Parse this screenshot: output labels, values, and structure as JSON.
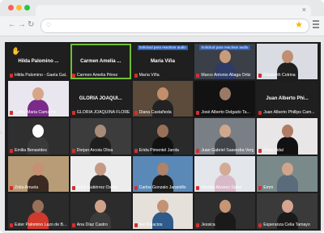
{
  "browser": {
    "tab_close": "×",
    "nav_back": "←",
    "nav_forward": "→",
    "nav_reload": "↻",
    "url_text": "",
    "globe_icon": "globe-icon",
    "star_icon": "star-icon",
    "menu_icon": "hamburger-menu-icon"
  },
  "meeting": {
    "tiles": [
      {
        "center": "Hilda Palomino ...",
        "name": "Hilda Palomino - Gaela Gal...",
        "hand": "✋",
        "bg": "#1f1f1f",
        "person": false
      },
      {
        "center": "Carmen Amelia ...",
        "name": "Carmen Amelia Pérez",
        "bg": "#1f1f1f",
        "active": true,
        "person": false
      },
      {
        "center": "María Viña",
        "tag": "Solicitud para reactivar audio",
        "name": "María Viña",
        "bg": "#1f1f1f",
        "person": false
      },
      {
        "tag": "Solicitud para reactivar audio",
        "name": "Marco Antonio Aliaga Ortiz",
        "bg": "#3b3f47",
        "person": true,
        "skin": "#c99b7d",
        "shirt": "#2e3b66"
      },
      {
        "name": "Elizabeth Cotrina",
        "bg": "#d9dde3",
        "person": true,
        "skin": "#c18d73",
        "shirt": "#202020"
      },
      {
        "name": "Cathy Maria Camacho",
        "bg": "#e9e6ef",
        "person": true,
        "skin": "#d7a587",
        "shirt": "#7a2a8a"
      },
      {
        "center": "GLORIA JOAQUI...",
        "name": "GLORIA JOAQUINA FLORE...",
        "bg": "#1f1f1f",
        "person": false
      },
      {
        "name": "Diana Castañeda",
        "bg": "#5c4a3b",
        "person": true,
        "skin": "#c48e6d",
        "shirt": "#222"
      },
      {
        "name": "José Alberto Delgado Ta...",
        "bg": "#121212",
        "person": true,
        "skin": "#9a7a65",
        "shirt": "#111"
      },
      {
        "center": "Juan Alberto Phi...",
        "name": "Juan Alberto Phillips Cam...",
        "bg": "#1f1f1f",
        "person": false
      },
      {
        "name": "Emilia Benavides",
        "bg": "#2f2f2f",
        "person": true,
        "skin": "#ffffff",
        "shirt": "#3a3a3a"
      },
      {
        "name": "Dorjan Arcoia Oliva",
        "bg": "#3c3c3c",
        "person": true,
        "skin": "#a88c79",
        "shirt": "#1e1e1e"
      },
      {
        "name": "Erida Pimentel Jarola",
        "bg": "#2a2a2a",
        "person": true,
        "skin": "#9b7059",
        "shirt": "#111"
      },
      {
        "name": "Juan Gabriel Saavedra Vergara",
        "bg": "#7a7f86",
        "person": true,
        "skin": "#cfa88c",
        "shirt": "#41444a"
      },
      {
        "name": "Frida Vidal",
        "bg": "#e8e6e6",
        "person": true,
        "skin": "#b07c63",
        "shirt": "#111"
      },
      {
        "name": "Zoila Arruela",
        "bg": "#b89b77",
        "person": true,
        "skin": "#c79073",
        "shirt": "#3a2a22"
      },
      {
        "name": "Erick Gutiérrez Osore",
        "bg": "#ececec",
        "person": true,
        "skin": "#c59a85",
        "shirt": "#2a2a2a"
      },
      {
        "name": "Carlos Gonzalo Jaramillo",
        "bg": "#5a89b7",
        "person": true,
        "skin": "#b08268",
        "shirt": "#1d1d1d"
      },
      {
        "name": "Mariela Alvarez Salas",
        "bg": "#e3e6ea",
        "person": true,
        "skin": "#d3aa95",
        "shirt": "#d8b9c7"
      },
      {
        "name": "Emm",
        "bg": "#7a8a8a",
        "person": true,
        "skin": "#cfa58c",
        "shirt": "#5a6b7a"
      },
      {
        "name": "Ester Palomino Lazo de B...",
        "bg": "#2b2b2b",
        "person": true,
        "skin": "#9a6f59",
        "shirt": "#d0392b"
      },
      {
        "name": "Ana Díaz Castro",
        "bg": "#2c2c2c",
        "person": true,
        "skin": "#d0a28a",
        "shirt": "#3b3b3b"
      },
      {
        "name": "Nei Palacios",
        "bg": "#e5e0da",
        "person": true,
        "skin": "#c39273",
        "shirt": "#2e5b8a"
      },
      {
        "name": "Jessica",
        "bg": "#2f2f2f",
        "person": true,
        "skin": "#c89576",
        "shirt": "#1a1a1a"
      },
      {
        "name": "Esperanza Celia Tamayo",
        "bg": "#3a3a3a",
        "person": true,
        "skin": "#d6a58f",
        "shirt": "#1a1a1a"
      }
    ]
  },
  "colors": {
    "active_speaker_border": "#6fbf33",
    "mic_muted": "#d32f2f",
    "request_tag": "#2d5fb8",
    "hand_raise": "#f7c600"
  }
}
